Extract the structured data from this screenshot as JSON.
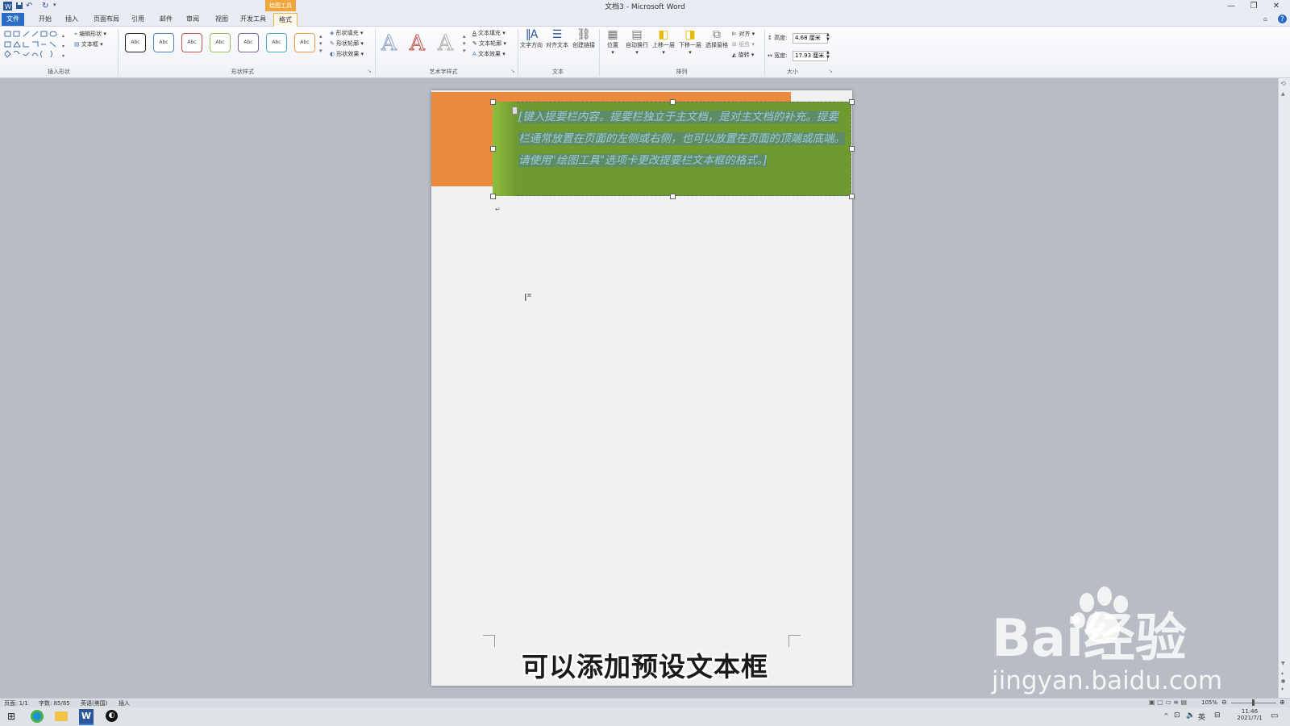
{
  "window": {
    "title": "文档3 - Microsoft Word",
    "minimize": "—",
    "restore": "❐",
    "close": "✕",
    "context_tab_group": "绘图工具"
  },
  "tabs": [
    {
      "label": "文件",
      "active": false
    },
    {
      "label": "开始",
      "active": false
    },
    {
      "label": "插入",
      "active": false
    },
    {
      "label": "页面布局",
      "active": false
    },
    {
      "label": "引用",
      "active": false
    },
    {
      "label": "邮件",
      "active": false
    },
    {
      "label": "审阅",
      "active": false
    },
    {
      "label": "视图",
      "active": false
    },
    {
      "label": "开发工具",
      "active": false
    },
    {
      "label": "格式",
      "active": true
    }
  ],
  "ribbon": {
    "groups": {
      "insert_shapes": "插入形状",
      "shape_styles": "形状样式",
      "wordart_styles": "艺术字样式",
      "text": "文本",
      "arrange": "排列",
      "size": "大小"
    },
    "edit_shape": "编辑形状",
    "text_box": "文本框",
    "style_sample": "Abc",
    "shape_fill": "形状填充",
    "shape_outline": "形状轮廓",
    "shape_effects": "形状效果",
    "text_fill": "文本填充",
    "text_outline": "文本轮廓",
    "text_effects": "文本效果",
    "wordart_letter": "A",
    "text_direction": "文字方向",
    "align_text": "对齐文本",
    "create_link": "创建链接",
    "position": "位置",
    "wrap_text": "自动换行",
    "bring_forward": "上移一层",
    "send_backward": "下移一层",
    "selection_pane": "选择窗格",
    "align": "对齐",
    "group": "组合",
    "rotate": "旋转",
    "height_label": "高度:",
    "height_value": "4.68 厘米",
    "width_label": "宽度:",
    "width_value": "17.93 厘米"
  },
  "document": {
    "sidebar_text": "[键入提要栏内容。提要栏独立于主文档，是对主文档的补充。提要栏通常放置在页面的左侧或右侧，也可以放置在页面的顶端或底端。请使用\"绘图工具\"选项卡更改提要栏文本框的格式。]",
    "paragraph_mark": "↵"
  },
  "statusbar": {
    "page": "页面: 1/1",
    "words": "字数: 85/85",
    "language": "英语(美国)",
    "mode": "插入",
    "zoom": "105%"
  },
  "taskbar": {
    "time": "11:46",
    "date": "2021/7/1",
    "ime": "英"
  },
  "overlay": {
    "subtitle": "可以添加预设文本框",
    "watermark_logo": "Bai经验",
    "watermark_url": "jingyan.baidu.com"
  },
  "colors": {
    "orange_shape": "#ea8a3c",
    "green_textbox": "#6e9a2f",
    "file_tab": "#2b6cc4",
    "context_tab": "#f0a63a"
  }
}
